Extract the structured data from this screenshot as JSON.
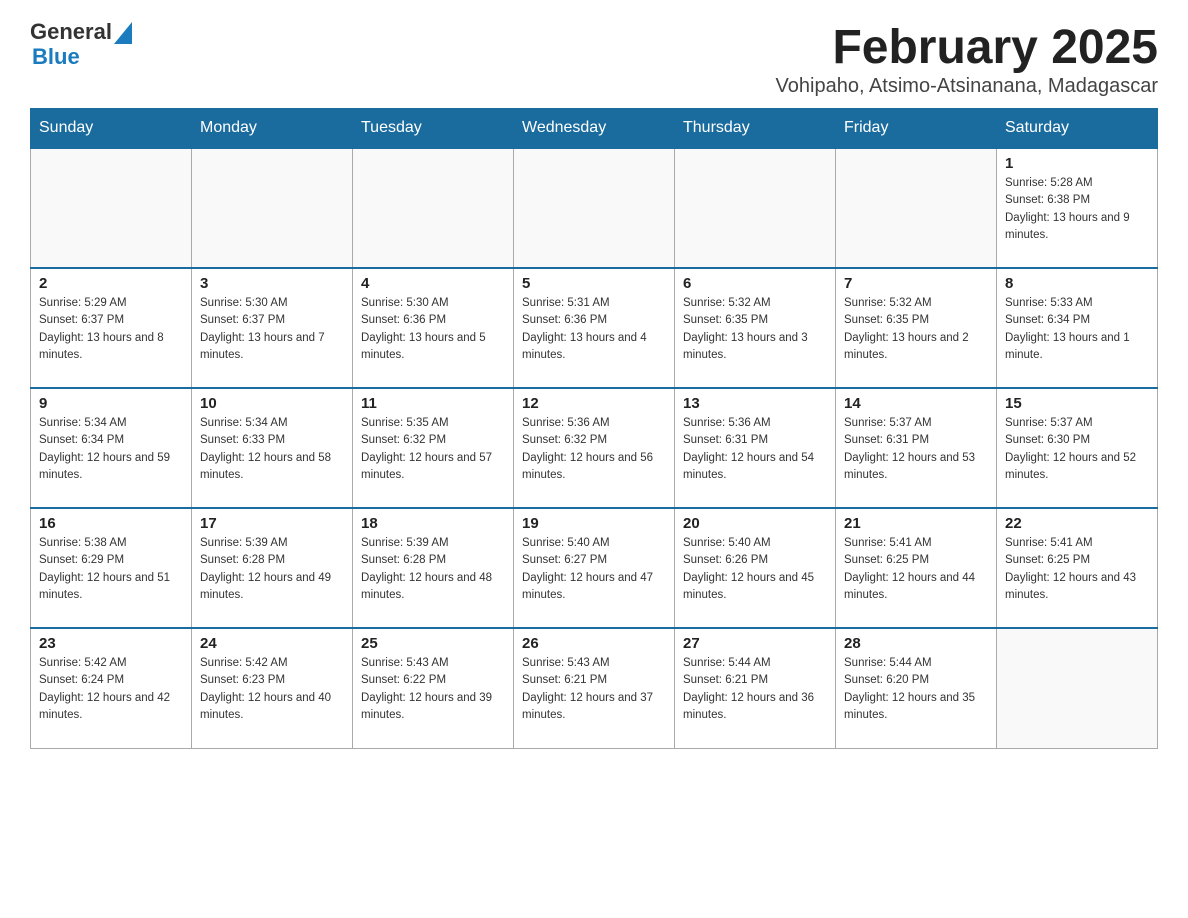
{
  "header": {
    "logo_general": "General",
    "logo_blue": "Blue",
    "month_title": "February 2025",
    "location": "Vohipaho, Atsimo-Atsinanana, Madagascar"
  },
  "weekdays": [
    "Sunday",
    "Monday",
    "Tuesday",
    "Wednesday",
    "Thursday",
    "Friday",
    "Saturday"
  ],
  "weeks": [
    [
      {
        "day": "",
        "sunrise": "",
        "sunset": "",
        "daylight": ""
      },
      {
        "day": "",
        "sunrise": "",
        "sunset": "",
        "daylight": ""
      },
      {
        "day": "",
        "sunrise": "",
        "sunset": "",
        "daylight": ""
      },
      {
        "day": "",
        "sunrise": "",
        "sunset": "",
        "daylight": ""
      },
      {
        "day": "",
        "sunrise": "",
        "sunset": "",
        "daylight": ""
      },
      {
        "day": "",
        "sunrise": "",
        "sunset": "",
        "daylight": ""
      },
      {
        "day": "1",
        "sunrise": "Sunrise: 5:28 AM",
        "sunset": "Sunset: 6:38 PM",
        "daylight": "Daylight: 13 hours and 9 minutes."
      }
    ],
    [
      {
        "day": "2",
        "sunrise": "Sunrise: 5:29 AM",
        "sunset": "Sunset: 6:37 PM",
        "daylight": "Daylight: 13 hours and 8 minutes."
      },
      {
        "day": "3",
        "sunrise": "Sunrise: 5:30 AM",
        "sunset": "Sunset: 6:37 PM",
        "daylight": "Daylight: 13 hours and 7 minutes."
      },
      {
        "day": "4",
        "sunrise": "Sunrise: 5:30 AM",
        "sunset": "Sunset: 6:36 PM",
        "daylight": "Daylight: 13 hours and 5 minutes."
      },
      {
        "day": "5",
        "sunrise": "Sunrise: 5:31 AM",
        "sunset": "Sunset: 6:36 PM",
        "daylight": "Daylight: 13 hours and 4 minutes."
      },
      {
        "day": "6",
        "sunrise": "Sunrise: 5:32 AM",
        "sunset": "Sunset: 6:35 PM",
        "daylight": "Daylight: 13 hours and 3 minutes."
      },
      {
        "day": "7",
        "sunrise": "Sunrise: 5:32 AM",
        "sunset": "Sunset: 6:35 PM",
        "daylight": "Daylight: 13 hours and 2 minutes."
      },
      {
        "day": "8",
        "sunrise": "Sunrise: 5:33 AM",
        "sunset": "Sunset: 6:34 PM",
        "daylight": "Daylight: 13 hours and 1 minute."
      }
    ],
    [
      {
        "day": "9",
        "sunrise": "Sunrise: 5:34 AM",
        "sunset": "Sunset: 6:34 PM",
        "daylight": "Daylight: 12 hours and 59 minutes."
      },
      {
        "day": "10",
        "sunrise": "Sunrise: 5:34 AM",
        "sunset": "Sunset: 6:33 PM",
        "daylight": "Daylight: 12 hours and 58 minutes."
      },
      {
        "day": "11",
        "sunrise": "Sunrise: 5:35 AM",
        "sunset": "Sunset: 6:32 PM",
        "daylight": "Daylight: 12 hours and 57 minutes."
      },
      {
        "day": "12",
        "sunrise": "Sunrise: 5:36 AM",
        "sunset": "Sunset: 6:32 PM",
        "daylight": "Daylight: 12 hours and 56 minutes."
      },
      {
        "day": "13",
        "sunrise": "Sunrise: 5:36 AM",
        "sunset": "Sunset: 6:31 PM",
        "daylight": "Daylight: 12 hours and 54 minutes."
      },
      {
        "day": "14",
        "sunrise": "Sunrise: 5:37 AM",
        "sunset": "Sunset: 6:31 PM",
        "daylight": "Daylight: 12 hours and 53 minutes."
      },
      {
        "day": "15",
        "sunrise": "Sunrise: 5:37 AM",
        "sunset": "Sunset: 6:30 PM",
        "daylight": "Daylight: 12 hours and 52 minutes."
      }
    ],
    [
      {
        "day": "16",
        "sunrise": "Sunrise: 5:38 AM",
        "sunset": "Sunset: 6:29 PM",
        "daylight": "Daylight: 12 hours and 51 minutes."
      },
      {
        "day": "17",
        "sunrise": "Sunrise: 5:39 AM",
        "sunset": "Sunset: 6:28 PM",
        "daylight": "Daylight: 12 hours and 49 minutes."
      },
      {
        "day": "18",
        "sunrise": "Sunrise: 5:39 AM",
        "sunset": "Sunset: 6:28 PM",
        "daylight": "Daylight: 12 hours and 48 minutes."
      },
      {
        "day": "19",
        "sunrise": "Sunrise: 5:40 AM",
        "sunset": "Sunset: 6:27 PM",
        "daylight": "Daylight: 12 hours and 47 minutes."
      },
      {
        "day": "20",
        "sunrise": "Sunrise: 5:40 AM",
        "sunset": "Sunset: 6:26 PM",
        "daylight": "Daylight: 12 hours and 45 minutes."
      },
      {
        "day": "21",
        "sunrise": "Sunrise: 5:41 AM",
        "sunset": "Sunset: 6:25 PM",
        "daylight": "Daylight: 12 hours and 44 minutes."
      },
      {
        "day": "22",
        "sunrise": "Sunrise: 5:41 AM",
        "sunset": "Sunset: 6:25 PM",
        "daylight": "Daylight: 12 hours and 43 minutes."
      }
    ],
    [
      {
        "day": "23",
        "sunrise": "Sunrise: 5:42 AM",
        "sunset": "Sunset: 6:24 PM",
        "daylight": "Daylight: 12 hours and 42 minutes."
      },
      {
        "day": "24",
        "sunrise": "Sunrise: 5:42 AM",
        "sunset": "Sunset: 6:23 PM",
        "daylight": "Daylight: 12 hours and 40 minutes."
      },
      {
        "day": "25",
        "sunrise": "Sunrise: 5:43 AM",
        "sunset": "Sunset: 6:22 PM",
        "daylight": "Daylight: 12 hours and 39 minutes."
      },
      {
        "day": "26",
        "sunrise": "Sunrise: 5:43 AM",
        "sunset": "Sunset: 6:21 PM",
        "daylight": "Daylight: 12 hours and 37 minutes."
      },
      {
        "day": "27",
        "sunrise": "Sunrise: 5:44 AM",
        "sunset": "Sunset: 6:21 PM",
        "daylight": "Daylight: 12 hours and 36 minutes."
      },
      {
        "day": "28",
        "sunrise": "Sunrise: 5:44 AM",
        "sunset": "Sunset: 6:20 PM",
        "daylight": "Daylight: 12 hours and 35 minutes."
      },
      {
        "day": "",
        "sunrise": "",
        "sunset": "",
        "daylight": ""
      }
    ]
  ]
}
